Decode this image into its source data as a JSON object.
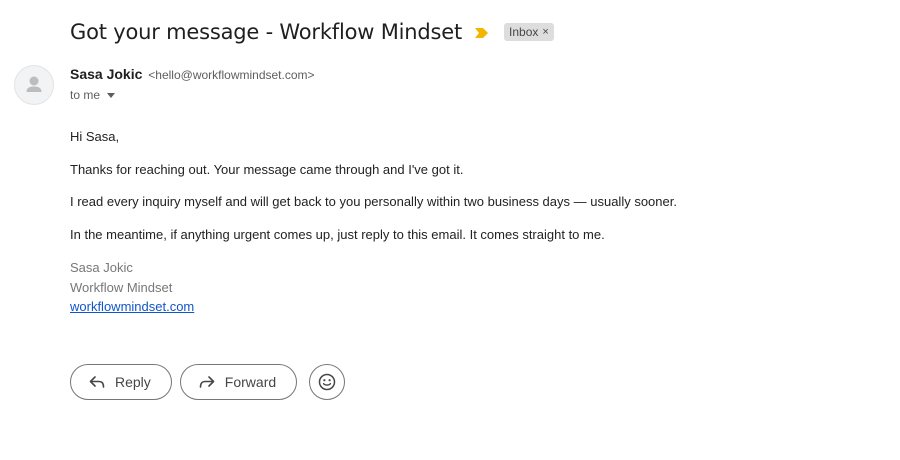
{
  "email": {
    "subject": "Got your message - Workflow Mindset",
    "label_chip": "Inbox",
    "label_chip_remove": "×",
    "sender": {
      "name": "Sasa Jokic",
      "email": "<hello@workflowmindset.com>"
    },
    "recipient": "to me",
    "body": {
      "greeting": "Hi Sasa,",
      "paragraphs": [
        "Thanks for reaching out. Your message came through and I've got it.",
        "I read every inquiry myself and will get back to you personally within two business days — usually sooner.",
        "In the meantime, if anything urgent comes up, just reply to this email. It comes straight to me."
      ]
    },
    "signature": {
      "name": "Sasa Jokic",
      "company": "Workflow Mindset",
      "website": "workflowmindset.com"
    }
  },
  "actions": {
    "reply_label": "Reply",
    "forward_label": "Forward"
  },
  "icons": {
    "importance": "importance-marker-icon",
    "avatar": "person-icon",
    "reply": "reply-arrow-icon",
    "forward": "forward-arrow-icon",
    "emoji": "smiley-face-icon",
    "dropdown": "caret-down-icon"
  },
  "colors": {
    "importance": "#f2b500",
    "label_chip_bg": "#dddddd",
    "link": "#1155cc",
    "signature_text": "#777777"
  }
}
